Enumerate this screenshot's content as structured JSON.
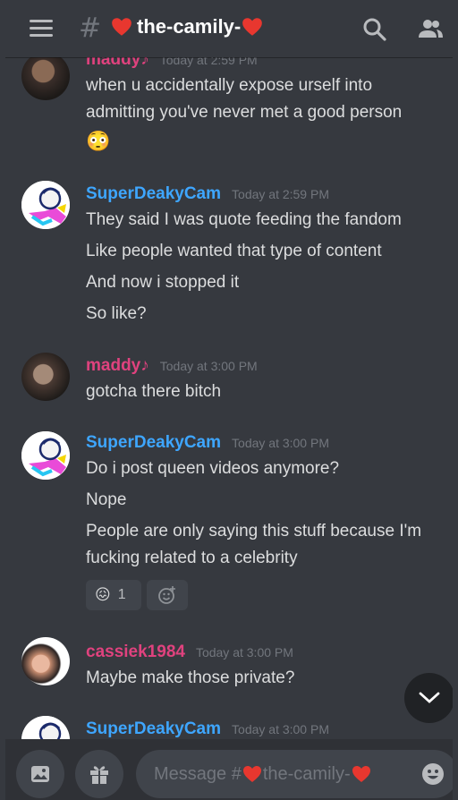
{
  "header": {
    "hash": "#",
    "channel_name": "the-camily-"
  },
  "messages": [
    {
      "author": "maddy♪",
      "author_color": "#e0427e",
      "timestamp": "Today at 2:59 PM",
      "lines": [
        "when u accidentally expose urself into",
        "admitting you've never met a good person",
        "😳"
      ]
    },
    {
      "author": "SuperDeakyCam",
      "author_color": "#3ea6ff",
      "timestamp": "Today at 2:59 PM",
      "lines": [
        "They said I was quote feeding the fandom",
        "Like people wanted that type of content",
        "And now i stopped it",
        "So like?"
      ]
    },
    {
      "author": "maddy♪",
      "author_color": "#e0427e",
      "timestamp": "Today at 3:00 PM",
      "lines": [
        "gotcha there bitch"
      ]
    },
    {
      "author": "SuperDeakyCam",
      "author_color": "#3ea6ff",
      "timestamp": "Today at 3:00 PM",
      "lines": [
        "Do i post queen videos anymore?",
        "Nope",
        "People are only saying this stuff because I'm",
        "fucking related to a celebrity"
      ],
      "reaction": {
        "emoji": "😖",
        "count": "1"
      }
    },
    {
      "author": "cassiek1984",
      "author_color": "#e0427e",
      "timestamp": "Today at 3:00 PM",
      "lines": [
        "Maybe make those private?"
      ]
    },
    {
      "author": "SuperDeakyCam",
      "author_color": "#3ea6ff",
      "timestamp": "Today at 3:00 PM",
      "lines": []
    }
  ],
  "composer": {
    "placeholder_prefix": "Message #",
    "placeholder_channel": "the-camily-"
  },
  "icons": {
    "menu": "hamburger-icon",
    "search": "search-icon",
    "members": "members-icon",
    "image": "image-icon",
    "gift": "gift-icon",
    "emoji": "emoji-icon",
    "add_reaction": "add-reaction-icon",
    "scroll_down": "chevron-down-icon"
  },
  "colors": {
    "background": "#36393f",
    "username_blue": "#3ea6ff",
    "username_pink": "#e0427e"
  }
}
